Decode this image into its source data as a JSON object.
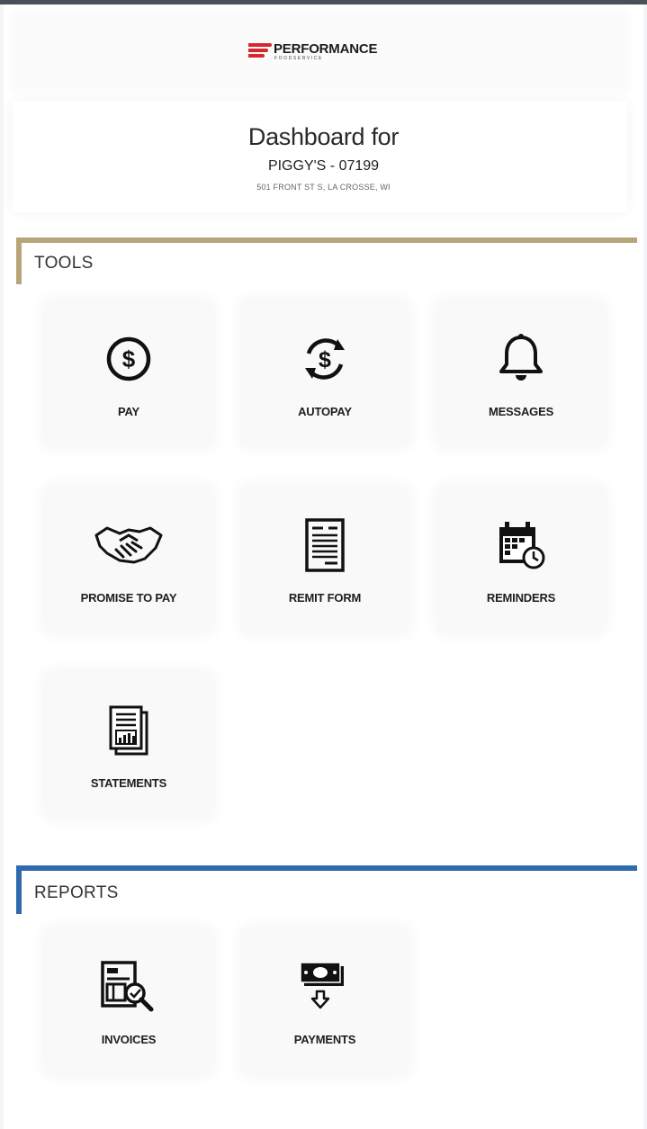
{
  "brand": {
    "name": "PERFORMANCE",
    "subtitle": "FOODSERVICE",
    "accent": "#d8262e"
  },
  "dashboard": {
    "title": "Dashboard for",
    "account": "PIGGY'S - 07199",
    "address": "501 FRONT ST S, LA CROSSE, WI"
  },
  "sections": {
    "tools": {
      "label": "TOOLS",
      "color": "#b9a57a",
      "items": [
        {
          "label": "PAY",
          "icon": "dollar-circle-icon"
        },
        {
          "label": "AUTOPAY",
          "icon": "autopay-cycle-icon"
        },
        {
          "label": "MESSAGES",
          "icon": "bell-icon"
        },
        {
          "label": "PROMISE TO PAY",
          "icon": "handshake-icon"
        },
        {
          "label": "REMIT FORM",
          "icon": "document-icon"
        },
        {
          "label": "REMINDERS",
          "icon": "calendar-clock-icon"
        },
        {
          "label": "STATEMENTS",
          "icon": "statement-chart-icon"
        }
      ]
    },
    "reports": {
      "label": "REPORTS",
      "color": "#2f6aae",
      "items": [
        {
          "label": "INVOICES",
          "icon": "invoice-search-icon"
        },
        {
          "label": "PAYMENTS",
          "icon": "cash-download-icon"
        }
      ]
    }
  }
}
